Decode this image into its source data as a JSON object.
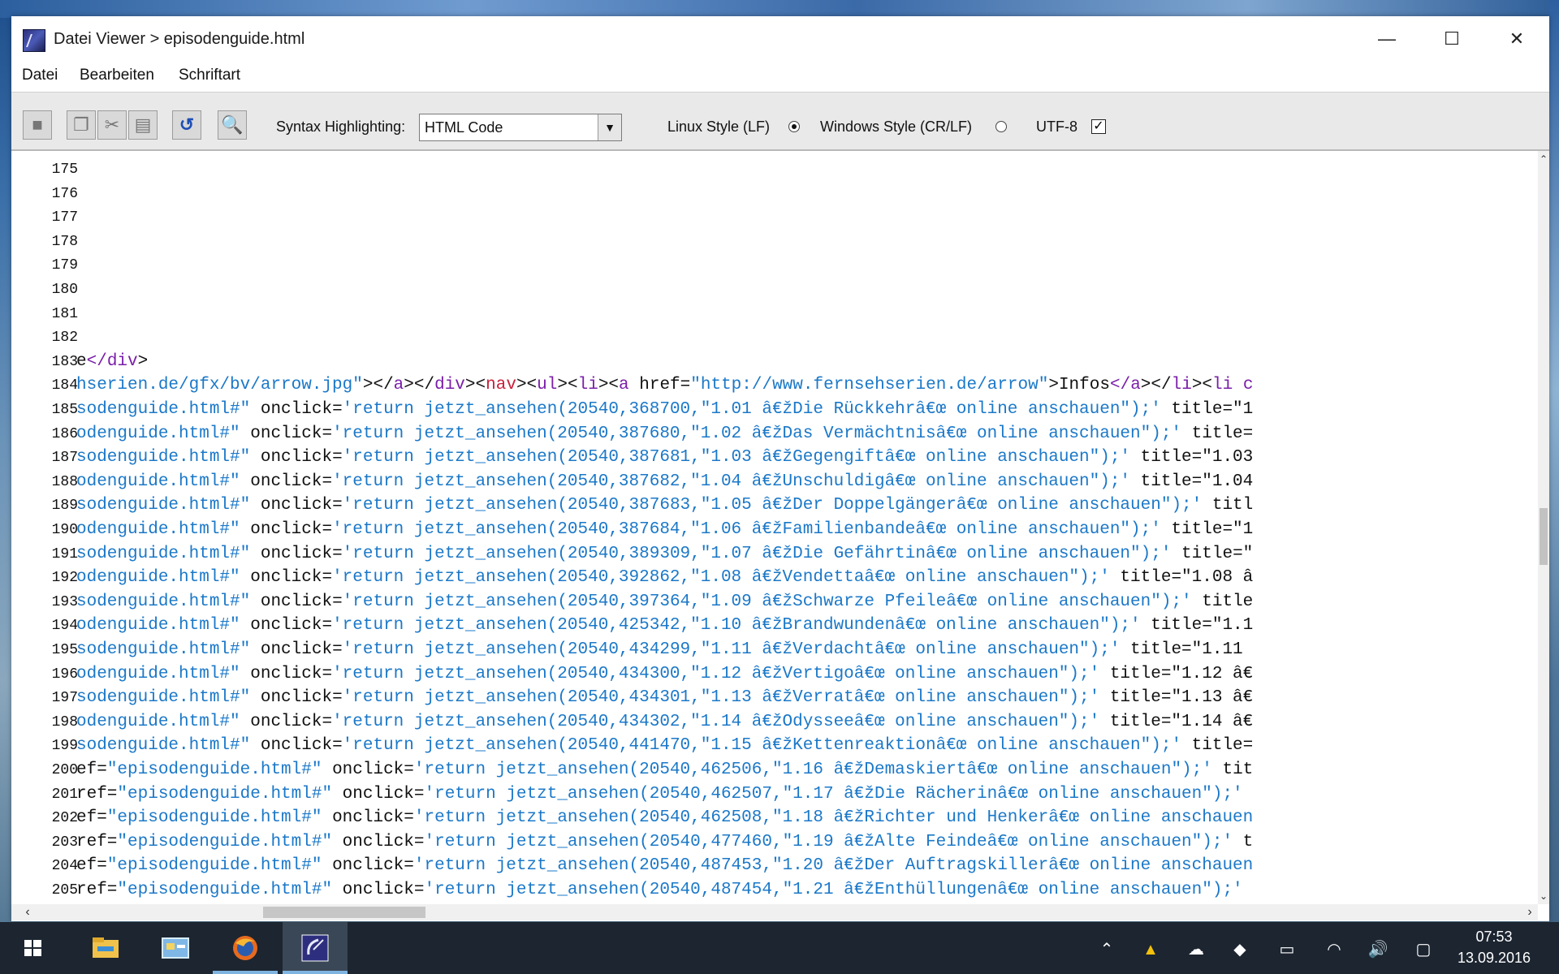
{
  "window": {
    "title": "Datei Viewer > episodenguide.html",
    "minimize_glyph": "—",
    "maximize_glyph": "☐",
    "close_glyph": "✕"
  },
  "menu": [
    "Datei",
    "Bearbeiten",
    "Schriftart"
  ],
  "toolbar": {
    "buttons": [
      {
        "icon": "save-icon",
        "glyph": "■"
      },
      {
        "icon": "copy-icon",
        "glyph": "❐"
      },
      {
        "icon": "cut-icon",
        "glyph": "✂"
      },
      {
        "icon": "paste-icon",
        "glyph": "▤"
      },
      {
        "icon": "undo-icon",
        "glyph": "↺"
      },
      {
        "icon": "search-icon",
        "glyph": "🔍"
      }
    ],
    "syntax_label": "Syntax Highlighting:",
    "syntax_value": "HTML Code",
    "linux_label": "Linux Style (LF)",
    "linux_selected": true,
    "windows_label": "Windows Style (CR/LF)",
    "windows_selected": false,
    "encoding_label": "UTF-8",
    "encoding_checked": true,
    "check_glyph": "✓"
  },
  "editor": {
    "lines": [
      {
        "n": "175",
        "segments": []
      },
      {
        "n": "176",
        "segments": []
      },
      {
        "n": "177",
        "segments": []
      },
      {
        "n": "178",
        "segments": []
      },
      {
        "n": "179",
        "segments": []
      },
      {
        "n": "180",
        "segments": []
      },
      {
        "n": "181",
        "segments": []
      },
      {
        "n": "182",
        "segments": []
      },
      {
        "n": "183",
        "segments": [
          {
            "t": "e",
            "c": "#111111"
          },
          {
            "t": "</",
            "c": "#7a1fa8"
          },
          {
            "t": "div",
            "c": "#7a1fa8"
          },
          {
            "t": ">",
            "c": "#111111"
          }
        ]
      },
      {
        "n": "184",
        "segments": [
          {
            "t": "hserien.de/gfx/bv/arrow.jpg\"",
            "c": "#1b78c8"
          },
          {
            "t": "></",
            "c": "#111111"
          },
          {
            "t": "a",
            "c": "#7a1fa8"
          },
          {
            "t": "></",
            "c": "#111111"
          },
          {
            "t": "div",
            "c": "#7a1fa8"
          },
          {
            "t": "><",
            "c": "#111111"
          },
          {
            "t": "nav",
            "c": "#c8203a"
          },
          {
            "t": "><",
            "c": "#111111"
          },
          {
            "t": "ul",
            "c": "#7a1fa8"
          },
          {
            "t": "><",
            "c": "#111111"
          },
          {
            "t": "li",
            "c": "#7a1fa8"
          },
          {
            "t": "><",
            "c": "#111111"
          },
          {
            "t": "a",
            "c": "#7a1fa8"
          },
          {
            "t": " href=",
            "c": "#111111"
          },
          {
            "t": "\"http://www.fernsehserien.de/arrow\"",
            "c": "#1b78c8"
          },
          {
            "t": ">Infos",
            "c": "#111111"
          },
          {
            "t": "</",
            "c": "#7a1fa8"
          },
          {
            "t": "a",
            "c": "#7a1fa8"
          },
          {
            "t": "></",
            "c": "#111111"
          },
          {
            "t": "li",
            "c": "#7a1fa8"
          },
          {
            "t": "><",
            "c": "#111111"
          },
          {
            "t": "li c",
            "c": "#7a1fa8"
          }
        ]
      },
      {
        "n": "185",
        "segments": [
          {
            "t": "sodenguide.html#\"",
            "c": "#1b78c8"
          },
          {
            "t": " onclick=",
            "c": "#111111"
          },
          {
            "t": "'return jetzt_ansehen(20540,368700,\"1.01 â€žDie Rückkehrâ€œ online anschauen\");'",
            "c": "#1b78c8"
          },
          {
            "t": " title=\"1",
            "c": "#111111"
          }
        ]
      },
      {
        "n": "186",
        "segments": [
          {
            "t": "odenguide.html#\"",
            "c": "#1b78c8"
          },
          {
            "t": " onclick=",
            "c": "#111111"
          },
          {
            "t": "'return jetzt_ansehen(20540,387680,\"1.02 â€žDas Vermächtnisâ€œ online anschauen\");'",
            "c": "#1b78c8"
          },
          {
            "t": " title=",
            "c": "#111111"
          }
        ]
      },
      {
        "n": "187",
        "segments": [
          {
            "t": "sodenguide.html#\"",
            "c": "#1b78c8"
          },
          {
            "t": " onclick=",
            "c": "#111111"
          },
          {
            "t": "'return jetzt_ansehen(20540,387681,\"1.03 â€žGegengiftâ€œ online anschauen\");'",
            "c": "#1b78c8"
          },
          {
            "t": " title=\"1.03",
            "c": "#111111"
          }
        ]
      },
      {
        "n": "188",
        "segments": [
          {
            "t": "odenguide.html#\"",
            "c": "#1b78c8"
          },
          {
            "t": " onclick=",
            "c": "#111111"
          },
          {
            "t": "'return jetzt_ansehen(20540,387682,\"1.04 â€žUnschuldigâ€œ online anschauen\");'",
            "c": "#1b78c8"
          },
          {
            "t": " title=\"1.04",
            "c": "#111111"
          }
        ]
      },
      {
        "n": "189",
        "segments": [
          {
            "t": "sodenguide.html#\"",
            "c": "#1b78c8"
          },
          {
            "t": " onclick=",
            "c": "#111111"
          },
          {
            "t": "'return jetzt_ansehen(20540,387683,\"1.05 â€žDer Doppelgängerâ€œ online anschauen\");'",
            "c": "#1b78c8"
          },
          {
            "t": " titl",
            "c": "#111111"
          }
        ]
      },
      {
        "n": "190",
        "segments": [
          {
            "t": "odenguide.html#\"",
            "c": "#1b78c8"
          },
          {
            "t": " onclick=",
            "c": "#111111"
          },
          {
            "t": "'return jetzt_ansehen(20540,387684,\"1.06 â€žFamilienbandeâ€œ online anschauen\");'",
            "c": "#1b78c8"
          },
          {
            "t": " title=\"1",
            "c": "#111111"
          }
        ]
      },
      {
        "n": "191",
        "segments": [
          {
            "t": "sodenguide.html#\"",
            "c": "#1b78c8"
          },
          {
            "t": " onclick=",
            "c": "#111111"
          },
          {
            "t": "'return jetzt_ansehen(20540,389309,\"1.07 â€žDie Gefährtinâ€œ online anschauen\");'",
            "c": "#1b78c8"
          },
          {
            "t": " title=\"",
            "c": "#111111"
          }
        ]
      },
      {
        "n": "192",
        "segments": [
          {
            "t": "odenguide.html#\"",
            "c": "#1b78c8"
          },
          {
            "t": " onclick=",
            "c": "#111111"
          },
          {
            "t": "'return jetzt_ansehen(20540,392862,\"1.08 â€žVendettaâ€œ online anschauen\");'",
            "c": "#1b78c8"
          },
          {
            "t": " title=\"1.08 â",
            "c": "#111111"
          }
        ]
      },
      {
        "n": "193",
        "segments": [
          {
            "t": "sodenguide.html#\"",
            "c": "#1b78c8"
          },
          {
            "t": " onclick=",
            "c": "#111111"
          },
          {
            "t": "'return jetzt_ansehen(20540,397364,\"1.09 â€žSchwarze Pfeileâ€œ online anschauen\");'",
            "c": "#1b78c8"
          },
          {
            "t": " title",
            "c": "#111111"
          }
        ]
      },
      {
        "n": "194",
        "segments": [
          {
            "t": "odenguide.html#\"",
            "c": "#1b78c8"
          },
          {
            "t": " onclick=",
            "c": "#111111"
          },
          {
            "t": "'return jetzt_ansehen(20540,425342,\"1.10 â€žBrandwundenâ€œ online anschauen\");'",
            "c": "#1b78c8"
          },
          {
            "t": " title=\"1.1",
            "c": "#111111"
          }
        ]
      },
      {
        "n": "195",
        "segments": [
          {
            "t": "sodenguide.html#\"",
            "c": "#1b78c8"
          },
          {
            "t": " onclick=",
            "c": "#111111"
          },
          {
            "t": "'return jetzt_ansehen(20540,434299,\"1.11 â€žVerdachtâ€œ online anschauen\");'",
            "c": "#1b78c8"
          },
          {
            "t": " title=\"1.11 ",
            "c": "#111111"
          }
        ]
      },
      {
        "n": "196",
        "segments": [
          {
            "t": "odenguide.html#\"",
            "c": "#1b78c8"
          },
          {
            "t": " onclick=",
            "c": "#111111"
          },
          {
            "t": "'return jetzt_ansehen(20540,434300,\"1.12 â€žVertigoâ€œ online anschauen\");'",
            "c": "#1b78c8"
          },
          {
            "t": " title=\"1.12 â€",
            "c": "#111111"
          }
        ]
      },
      {
        "n": "197",
        "segments": [
          {
            "t": "sodenguide.html#\"",
            "c": "#1b78c8"
          },
          {
            "t": " onclick=",
            "c": "#111111"
          },
          {
            "t": "'return jetzt_ansehen(20540,434301,\"1.13 â€žVerratâ€œ online anschauen\");'",
            "c": "#1b78c8"
          },
          {
            "t": " title=\"1.13 â€",
            "c": "#111111"
          }
        ]
      },
      {
        "n": "198",
        "segments": [
          {
            "t": "odenguide.html#\"",
            "c": "#1b78c8"
          },
          {
            "t": " onclick=",
            "c": "#111111"
          },
          {
            "t": "'return jetzt_ansehen(20540,434302,\"1.14 â€žOdysseeâ€œ online anschauen\");'",
            "c": "#1b78c8"
          },
          {
            "t": " title=\"1.14 â€",
            "c": "#111111"
          }
        ]
      },
      {
        "n": "199",
        "segments": [
          {
            "t": "sodenguide.html#\"",
            "c": "#1b78c8"
          },
          {
            "t": " onclick=",
            "c": "#111111"
          },
          {
            "t": "'return jetzt_ansehen(20540,441470,\"1.15 â€žKettenreaktionâ€œ online anschauen\");'",
            "c": "#1b78c8"
          },
          {
            "t": " title=",
            "c": "#111111"
          }
        ]
      },
      {
        "n": "200",
        "segments": [
          {
            "t": "ef=",
            "c": "#111111"
          },
          {
            "t": "\"episodenguide.html#\"",
            "c": "#1b78c8"
          },
          {
            "t": " onclick=",
            "c": "#111111"
          },
          {
            "t": "'return jetzt_ansehen(20540,462506,\"1.16 â€žDemaskiertâ€œ online anschauen\");'",
            "c": "#1b78c8"
          },
          {
            "t": " tit",
            "c": "#111111"
          }
        ]
      },
      {
        "n": "201",
        "segments": [
          {
            "t": "ref=",
            "c": "#111111"
          },
          {
            "t": "\"episodenguide.html#\"",
            "c": "#1b78c8"
          },
          {
            "t": " onclick=",
            "c": "#111111"
          },
          {
            "t": "'return jetzt_ansehen(20540,462507,\"1.17 â€žDie Rächerinâ€œ online anschauen\");'",
            "c": "#1b78c8"
          },
          {
            "t": " ",
            "c": "#111111"
          }
        ]
      },
      {
        "n": "202",
        "segments": [
          {
            "t": "ef=",
            "c": "#111111"
          },
          {
            "t": "\"episodenguide.html#\"",
            "c": "#1b78c8"
          },
          {
            "t": " onclick=",
            "c": "#111111"
          },
          {
            "t": "'return jetzt_ansehen(20540,462508,\"1.18 â€žRichter und Henkerâ€œ online anschauen",
            "c": "#1b78c8"
          }
        ]
      },
      {
        "n": "203",
        "segments": [
          {
            "t": "ref=",
            "c": "#111111"
          },
          {
            "t": "\"episodenguide.html#\"",
            "c": "#1b78c8"
          },
          {
            "t": " onclick=",
            "c": "#111111"
          },
          {
            "t": "'return jetzt_ansehen(20540,477460,\"1.19 â€žAlte Feindeâ€œ online anschauen\");'",
            "c": "#1b78c8"
          },
          {
            "t": " t",
            "c": "#111111"
          }
        ]
      },
      {
        "n": "204",
        "segments": [
          {
            "t": "ef=",
            "c": "#111111"
          },
          {
            "t": "\"episodenguide.html#\"",
            "c": "#1b78c8"
          },
          {
            "t": " onclick=",
            "c": "#111111"
          },
          {
            "t": "'return jetzt_ansehen(20540,487453,\"1.20 â€žDer Auftragskillerâ€œ online anschauen",
            "c": "#1b78c8"
          }
        ]
      },
      {
        "n": "205",
        "segments": [
          {
            "t": "ref=",
            "c": "#111111"
          },
          {
            "t": "\"episodenguide.html#\"",
            "c": "#1b78c8"
          },
          {
            "t": " onclick=",
            "c": "#111111"
          },
          {
            "t": "'return jetzt_ansehen(20540,487454,\"1.21 â€žEnthüllungenâ€œ online anschauen\");'",
            "c": "#1b78c8"
          },
          {
            "t": " ",
            "c": "#111111"
          }
        ]
      }
    ]
  },
  "scroll": {
    "up": "⌃",
    "down": "⌄",
    "left": "‹",
    "right": "›"
  },
  "taskbar": {
    "apps": [
      {
        "name": "start-button",
        "icon": "windows-logo-icon"
      },
      {
        "name": "file-explorer-app",
        "icon": "folder-icon"
      },
      {
        "name": "control-panel-app",
        "icon": "control-panel-icon"
      },
      {
        "name": "firefox-app",
        "icon": "firefox-icon"
      },
      {
        "name": "datei-viewer-app",
        "icon": "satellite-dish-icon"
      }
    ],
    "tray": [
      {
        "name": "tray-chevron",
        "icon": "chevron-up-icon",
        "glyph": "⌃"
      },
      {
        "name": "tray-google-drive",
        "icon": "google-drive-icon",
        "glyph": "▲"
      },
      {
        "name": "tray-onedrive",
        "icon": "cloud-icon",
        "glyph": "☁"
      },
      {
        "name": "tray-dropbox",
        "icon": "dropbox-icon",
        "glyph": "◆"
      },
      {
        "name": "tray-battery",
        "icon": "battery-icon",
        "glyph": "▭"
      },
      {
        "name": "tray-network",
        "icon": "wifi-icon",
        "glyph": "◠"
      },
      {
        "name": "tray-volume",
        "icon": "volume-icon",
        "glyph": "🔊"
      },
      {
        "name": "tray-notifications",
        "icon": "action-center-icon",
        "glyph": "▢"
      }
    ],
    "time": "07:53",
    "date": "13.09.2016"
  }
}
